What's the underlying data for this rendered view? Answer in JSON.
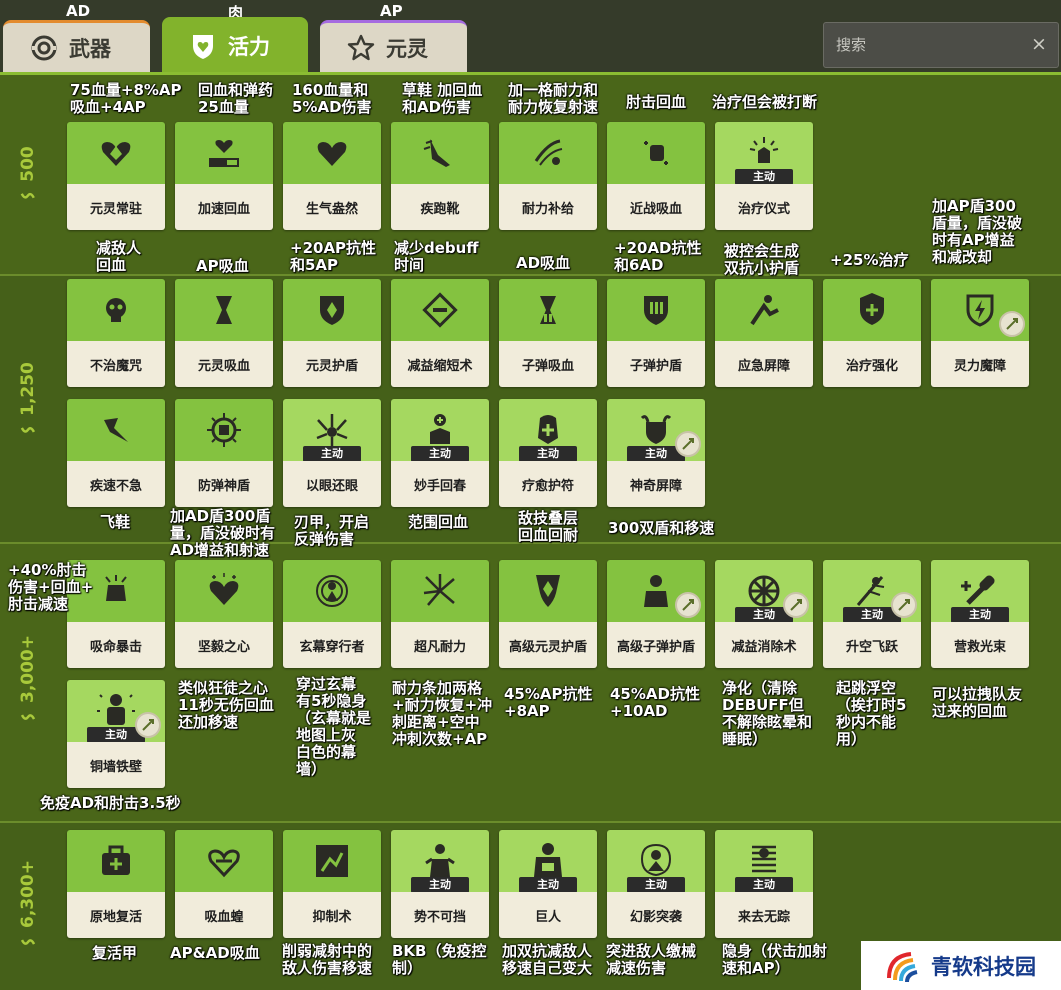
{
  "tabs": [
    {
      "caption": "AD",
      "label": "武器",
      "icon": "weapon-icon"
    },
    {
      "caption": "肉",
      "label": "活力",
      "icon": "vitality-icon"
    },
    {
      "caption": "AP",
      "label": "元灵",
      "icon": "spirit-icon"
    }
  ],
  "search": {
    "placeholder": "搜索",
    "close": "×"
  },
  "active_badge": "主动",
  "colors": {
    "tab_weapon_accent": "#e38b2e",
    "tab_spirit_accent": "#a56be0",
    "vitality": "#82b32c",
    "card_art": "#84c240"
  },
  "tiers": [
    {
      "price": "500"
    },
    {
      "price": "1,250"
    },
    {
      "price": "3,000+"
    },
    {
      "price": "6,300+"
    }
  ],
  "items": [
    {
      "name": "元灵常驻",
      "icon": "spirit-heart-icon",
      "active": false
    },
    {
      "name": "加速回血",
      "icon": "health-bar-icon",
      "active": false
    },
    {
      "name": "生气盎然",
      "icon": "heart-icon",
      "active": false
    },
    {
      "name": "疾跑靴",
      "icon": "sprint-boots-icon",
      "active": false
    },
    {
      "name": "耐力补给",
      "icon": "stamina-icon",
      "active": false
    },
    {
      "name": "近战吸血",
      "icon": "melee-lifesteal-icon",
      "active": false
    },
    {
      "name": "治疗仪式",
      "icon": "healing-ritual-icon",
      "active": true
    },
    {
      "name": "不治魔咒",
      "icon": "skull-curse-icon",
      "active": false
    },
    {
      "name": "元灵吸血",
      "icon": "spirit-lifesteal-icon",
      "active": false
    },
    {
      "name": "元灵护盾",
      "icon": "spirit-shield-icon",
      "active": false
    },
    {
      "name": "减益缩短术",
      "icon": "debuff-reducer-icon",
      "active": false
    },
    {
      "name": "子弹吸血",
      "icon": "bullet-lifesteal-icon",
      "active": false
    },
    {
      "name": "子弹护盾",
      "icon": "bullet-shield-icon",
      "active": false
    },
    {
      "name": "应急屏障",
      "icon": "emergency-barrier-icon",
      "active": false
    },
    {
      "name": "治疗强化",
      "icon": "healing-boost-icon",
      "active": false
    },
    {
      "name": "灵力魔障",
      "icon": "spirit-barrier-icon",
      "active": false
    },
    {
      "name": "疾速不急",
      "icon": "swift-icon",
      "active": false
    },
    {
      "name": "防弹神盾",
      "icon": "bulletproof-shield-icon",
      "active": false
    },
    {
      "name": "以眼还眼",
      "icon": "return-fire-icon",
      "active": true
    },
    {
      "name": "妙手回春",
      "icon": "heal-hand-icon",
      "active": true
    },
    {
      "name": "疗愈护符",
      "icon": "healing-amulet-icon",
      "active": true
    },
    {
      "name": "神奇屏障",
      "icon": "magic-barrier-icon",
      "active": true
    },
    {
      "name": "吸命暴击",
      "icon": "lifesteal-crit-icon",
      "active": false
    },
    {
      "name": "坚毅之心",
      "icon": "fortitude-heart-icon",
      "active": false
    },
    {
      "name": "玄幕穿行者",
      "icon": "veil-walker-icon",
      "active": false
    },
    {
      "name": "超凡耐力",
      "icon": "superior-stamina-icon",
      "active": false
    },
    {
      "name": "高级元灵护盾",
      "icon": "improved-spirit-shield-icon",
      "active": false
    },
    {
      "name": "高级子弹护盾",
      "icon": "improved-bullet-shield-icon",
      "active": false
    },
    {
      "name": "减益消除术",
      "icon": "debuff-remover-icon",
      "active": true
    },
    {
      "name": "升空飞跃",
      "icon": "leap-icon",
      "active": true
    },
    {
      "name": "营救光束",
      "icon": "rescue-beam-icon",
      "active": true
    },
    {
      "name": "铜墙铁壁",
      "icon": "metal-skin-icon",
      "active": true
    },
    {
      "name": "原地复活",
      "icon": "revive-icon",
      "active": false
    },
    {
      "name": "吸血蝗",
      "icon": "leech-icon",
      "active": false
    },
    {
      "name": "抑制术",
      "icon": "inhibitor-icon",
      "active": false
    },
    {
      "name": "势不可挡",
      "icon": "unstoppable-icon",
      "active": true
    },
    {
      "name": "巨人",
      "icon": "colossus-icon",
      "active": true
    },
    {
      "name": "幻影突袭",
      "icon": "phantom-strike-icon",
      "active": true
    },
    {
      "name": "来去无踪",
      "icon": "vanish-icon",
      "active": true
    }
  ],
  "notes": [
    "75血量+8%AP\n吸血+4AP",
    "回血和弹药\n25血量",
    "160血量和\n5%AD伤害",
    "草鞋 加回血\n和AD伤害",
    "加一格耐力和\n耐力恢复射速",
    "肘击回血",
    "治疗但会被打断",
    "减敌人\n回血",
    "AP吸血",
    "+20AP抗性\n和5AP",
    "减少debuff\n时间",
    "AD吸血",
    "+20AD抗性\n和6AD",
    "被控会生成\n双抗小护盾",
    "+25%治疗",
    "加AP盾300\n盾量，盾没破\n时有AP增益\n和减改却",
    "飞鞋",
    "加AD盾300盾\n量，盾没破时有\nAD增益和射速",
    "刃甲，开启\n反弹伤害",
    "范围回血",
    "敌技叠层\n回血回耐",
    "300双盾和移速",
    "+40%肘击\n伤害+回血+\n肘击减速",
    "类似狂徒之心\n11秒无伤回血\n还加移速",
    "穿过玄幕\n有5秒隐身\n（玄幕就是\n地图上灰\n白色的幕\n墙）",
    "耐力条加两格\n+耐力恢复+冲\n刺距离+空中\n冲刺次数+AP",
    "45%AP抗性\n+8AP",
    "45%AD抗性\n+10AD",
    "净化（清除\nDEBUFF但\n不解除眩晕和\n睡眠）",
    "起跳浮空\n（挨打时5\n秒内不能\n用）",
    "可以拉拽队友\n过来的回血",
    "免疫AD和肘击3.5秒",
    "复活甲",
    "AP&AD吸血",
    "削弱减射中的\n敌人伤害移速",
    "BKB（免疫控\n制）",
    "加双抗减敌人\n移速自己变大",
    "突进敌人缴械\n减速伤害",
    "隐身（伏击加射\n速和AP）"
  ],
  "watermark": {
    "text": "青软科技园",
    "icon": "signal-logo-icon"
  }
}
